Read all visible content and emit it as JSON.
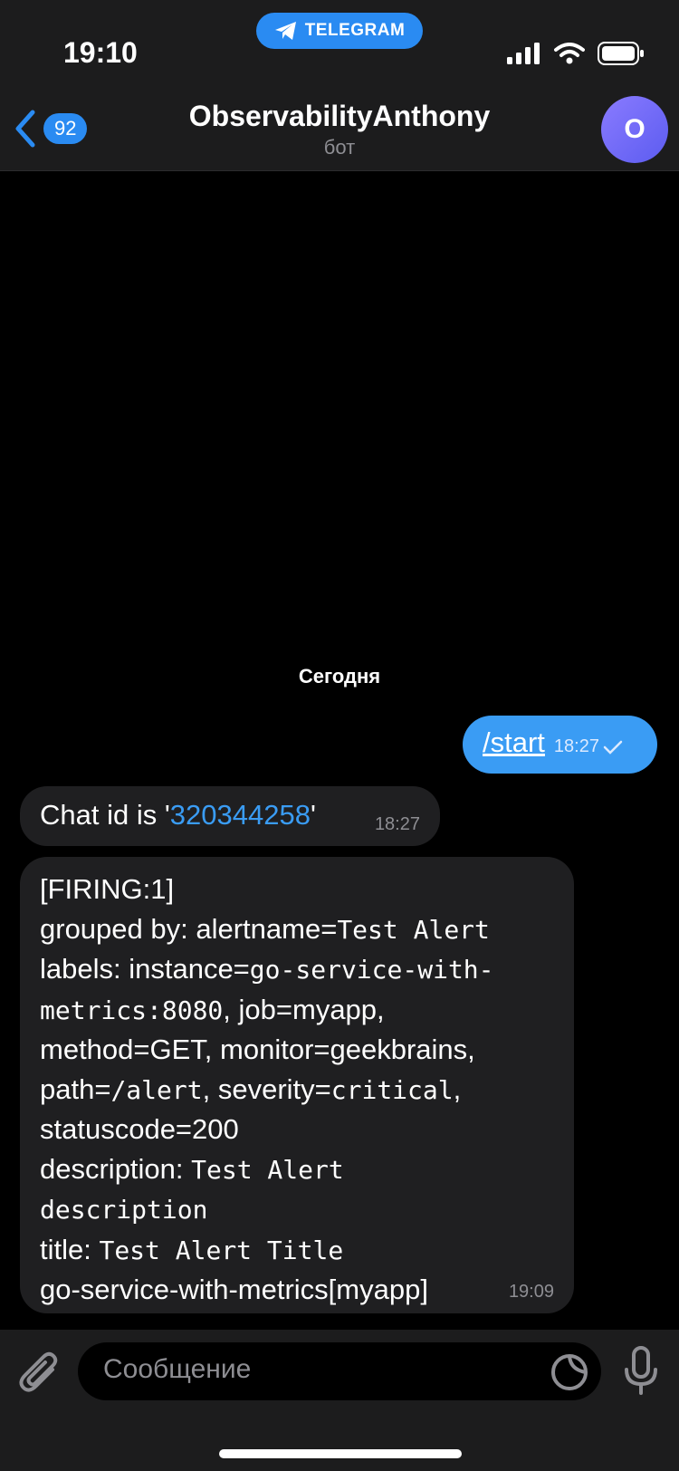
{
  "status": {
    "time": "19:10",
    "app_pill": "TELEGRAM"
  },
  "header": {
    "back_count": "92",
    "title": "ObservabilityAnthony",
    "subtitle": "бот",
    "avatar_letter": "O"
  },
  "chat": {
    "date_separator": "Сегодня",
    "outgoing": {
      "text": "/start",
      "time": "18:27"
    },
    "chat_id_message": {
      "prefix": "Chat id is '",
      "chat_id": "320344258",
      "suffix": "'",
      "time": "18:27"
    },
    "alert_message": {
      "lines": [
        {
          "label": "[FIRING:1]",
          "value": ""
        },
        {
          "label": "grouped by: alertname=",
          "value": "Test Alert"
        },
        {
          "label": "labels: instance=",
          "value": "go-service-with-"
        },
        {
          "label": "",
          "value": "metrics:8080",
          "tail": ", job=myapp,"
        },
        {
          "label": "method=GET, monitor=geekbrains,",
          "value": ""
        },
        {
          "label": "path=",
          "value": "/alert",
          "tail": ", severity=",
          "value2": "critical",
          "tail2": ","
        },
        {
          "label": "statuscode=200",
          "value": ""
        },
        {
          "label": "description: ",
          "value": "Test Alert"
        },
        {
          "label": "",
          "value": "description"
        },
        {
          "label": "title: ",
          "value": "Test Alert Title"
        },
        {
          "label": "go-service-with-metrics[myapp]",
          "value": ""
        }
      ],
      "time": "19:09"
    }
  },
  "input": {
    "placeholder": "Сообщение"
  },
  "icons": [
    "telegram-plane-icon",
    "signal-icon",
    "wifi-icon",
    "battery-icon",
    "back-chevron-icon",
    "check-icon",
    "paperclip-icon",
    "sticker-icon",
    "mic-icon"
  ]
}
